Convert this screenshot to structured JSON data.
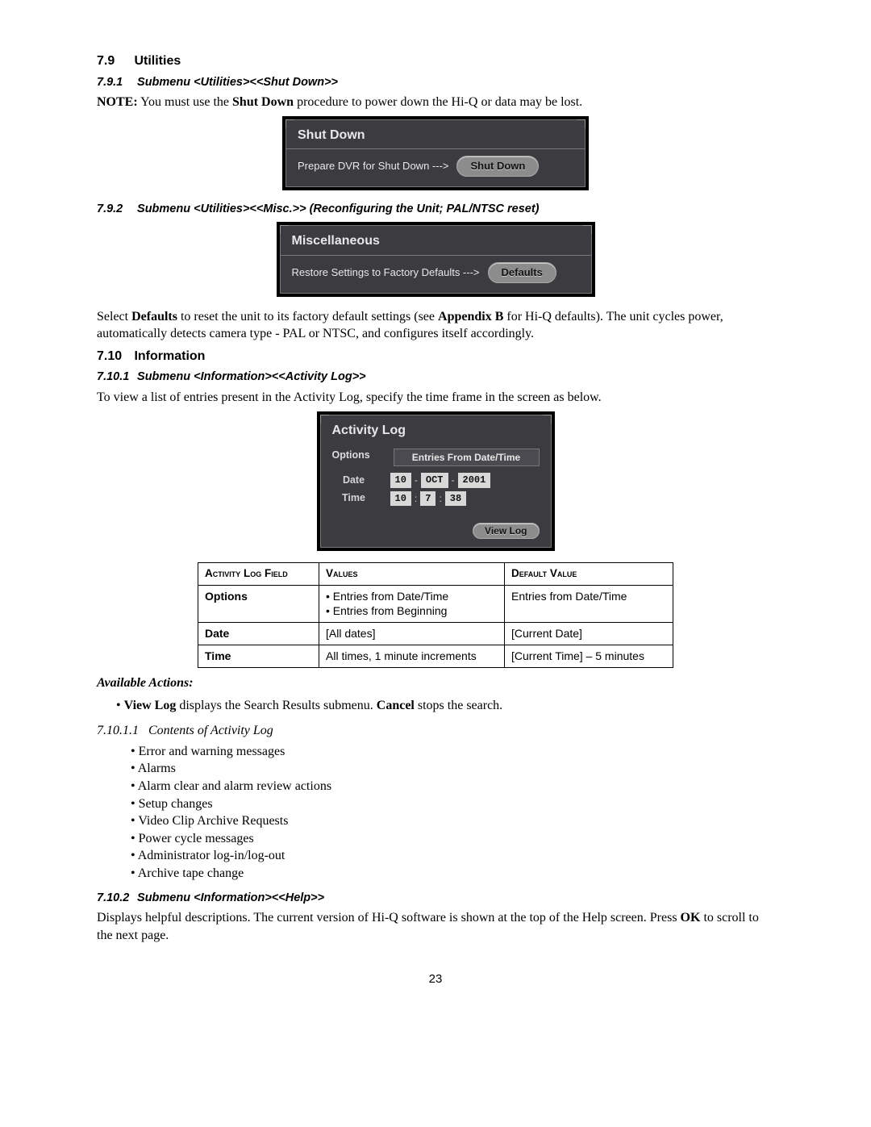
{
  "s79": {
    "num": "7.9",
    "title": "Utilities",
    "s791": {
      "num": "7.9.1",
      "title": "Submenu <Utilities><<Shut Down>>",
      "note_label": "NOTE:",
      "note_mid": " You must use the ",
      "note_bold": "Shut Down",
      "note_end": " procedure to power down the Hi-Q or data may be lost.",
      "panel_title": "Shut Down",
      "panel_text": "Prepare DVR for Shut Down --->",
      "panel_button": "Shut Down"
    },
    "s792": {
      "num": "7.9.2",
      "title": "Submenu <Utilities><<Misc.>> (Reconfiguring the Unit; PAL/NTSC reset)",
      "panel_title": "Miscellaneous",
      "panel_text": "Restore Settings to Factory Defaults --->",
      "panel_button": "Defaults",
      "para_a": "Select ",
      "para_b": "Defaults",
      "para_c": " to reset the unit to its factory default settings (see ",
      "para_d": "Appendix B",
      "para_e": " for Hi-Q defaults). The unit cycles power, automatically detects camera type - PAL or NTSC, and configures itself accordingly."
    }
  },
  "s710": {
    "num": "7.10",
    "title": "Information",
    "s7101": {
      "num": "7.10.1",
      "title": "Submenu <Information><<Activity Log>>",
      "para": "To view a list of entries present in the Activity Log, specify the time frame in the screen as below.",
      "panel": {
        "title": "Activity Log",
        "options_label": "Options",
        "options_header": "Entries From Date/Time",
        "date_label": "Date",
        "date_day": "10",
        "date_sep1": "-",
        "date_mon": "OCT",
        "date_sep2": "-",
        "date_year": "2001",
        "time_label": "Time",
        "time_h": "10",
        "time_sep1": ":",
        "time_m": "7",
        "time_sep2": ":",
        "time_s": "38",
        "view_button": "View Log"
      },
      "table": {
        "h1": "Activity Log Field",
        "h2": "Values",
        "h3": "Default Value",
        "rows": [
          {
            "f": "Options",
            "v": [
              "Entries from Date/Time",
              "Entries from Beginning"
            ],
            "d": "Entries from Date/Time"
          },
          {
            "f": "Date",
            "v": [
              "[All dates]"
            ],
            "d": "[Current Date]"
          },
          {
            "f": "Time",
            "v": [
              "All times, 1 minute increments"
            ],
            "d": "[Current Time] – 5 minutes"
          }
        ]
      },
      "actions_title": "Available Actions:",
      "action_pre": "View Log",
      "action_mid": " displays the Search Results submenu. ",
      "action_bold2": "Cancel",
      "action_end": " stops the search.",
      "s71011": {
        "num": "7.10.1.1",
        "title": "Contents of Activity Log",
        "items": [
          "Error and warning messages",
          "Alarms",
          "Alarm clear and alarm review actions",
          "Setup changes",
          "Video Clip Archive Requests",
          "Power cycle messages",
          "Administrator log-in/log-out",
          "Archive tape change"
        ]
      }
    },
    "s7102": {
      "num": "7.10.2",
      "title": "Submenu <Information><<Help>>",
      "para_a": "Displays helpful descriptions. The current version of Hi-Q software is shown at the top of the Help screen. Press ",
      "para_b": "OK",
      "para_c": " to scroll to the next page."
    }
  },
  "pagenum": "23"
}
